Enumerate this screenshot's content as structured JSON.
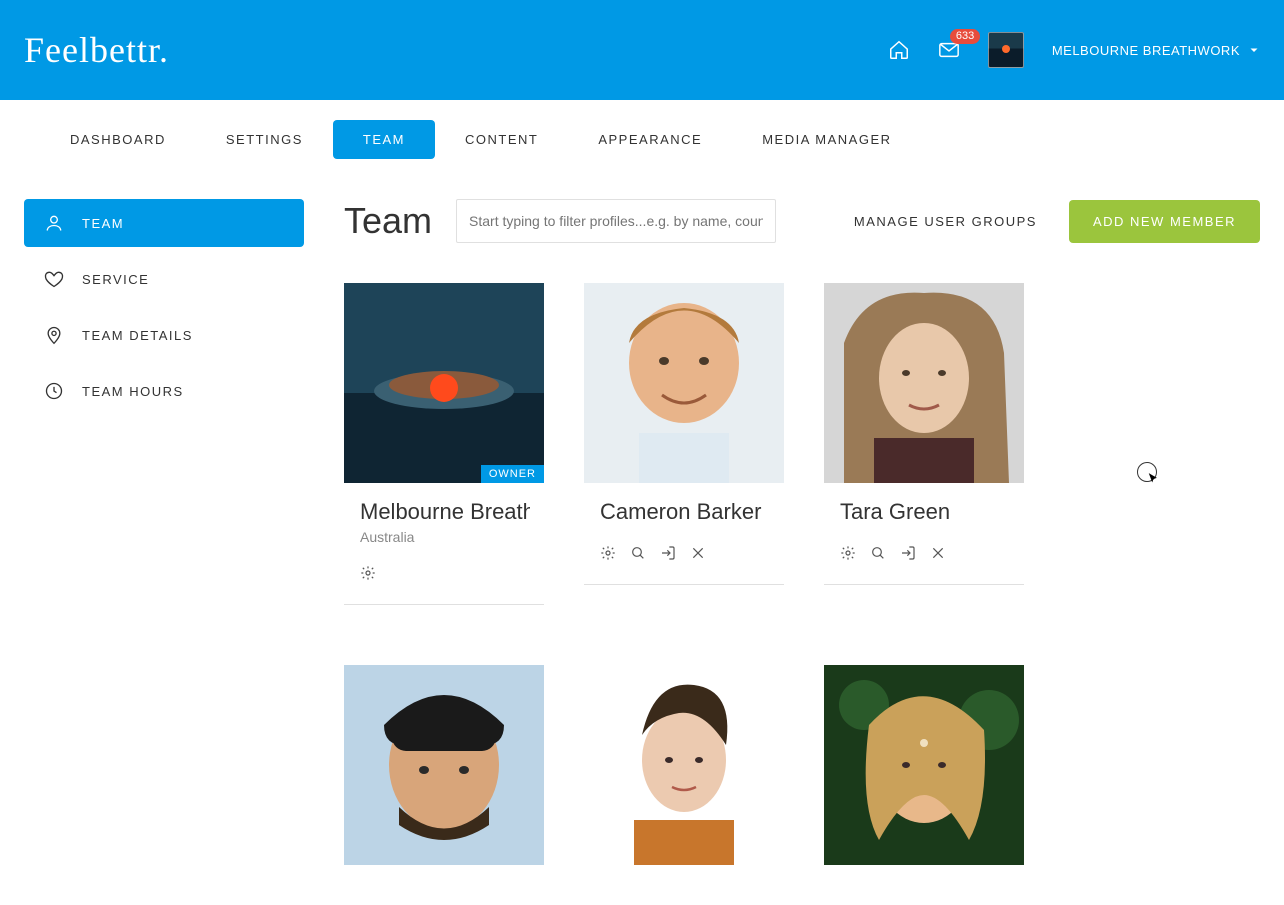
{
  "brand": {
    "name": "Feelbettr"
  },
  "header": {
    "notifications_count": "633",
    "account_name": "MELBOURNE BREATHWORK"
  },
  "nav": {
    "items": [
      {
        "label": "DASHBOARD",
        "active": false
      },
      {
        "label": "SETTINGS",
        "active": false
      },
      {
        "label": "TEAM",
        "active": true
      },
      {
        "label": "CONTENT",
        "active": false
      },
      {
        "label": "APPEARANCE",
        "active": false
      },
      {
        "label": "MEDIA MANAGER",
        "active": false
      }
    ]
  },
  "sidebar": {
    "items": [
      {
        "label": "TEAM",
        "icon": "person-icon",
        "active": true
      },
      {
        "label": "SERVICE",
        "icon": "heart-icon",
        "active": false
      },
      {
        "label": "TEAM DETAILS",
        "icon": "pin-icon",
        "active": false
      },
      {
        "label": "TEAM HOURS",
        "icon": "clock-icon",
        "active": false
      }
    ]
  },
  "main": {
    "title": "Team",
    "filter_placeholder": "Start typing to filter profiles...e.g. by name, country",
    "manage_groups_label": "MANAGE USER GROUPS",
    "add_member_label": "ADD NEW MEMBER",
    "owner_tag": "OWNER",
    "members": [
      {
        "name": "Melbourne Breathwork",
        "subtitle": "Australia",
        "is_owner": true,
        "actions": [
          "settings"
        ]
      },
      {
        "name": "Cameron Barker",
        "subtitle": "",
        "is_owner": false,
        "actions": [
          "settings",
          "view",
          "login",
          "remove"
        ]
      },
      {
        "name": "Tara Green",
        "subtitle": "",
        "is_owner": false,
        "actions": [
          "settings",
          "view",
          "login",
          "remove"
        ]
      },
      {
        "name": "",
        "subtitle": "",
        "is_owner": false,
        "actions": []
      },
      {
        "name": "",
        "subtitle": "",
        "is_owner": false,
        "actions": []
      },
      {
        "name": "",
        "subtitle": "",
        "is_owner": false,
        "actions": []
      }
    ]
  },
  "colors": {
    "brand_blue": "#0099e5",
    "accent_green": "#9bc53d",
    "badge_red": "#e74c3c"
  }
}
